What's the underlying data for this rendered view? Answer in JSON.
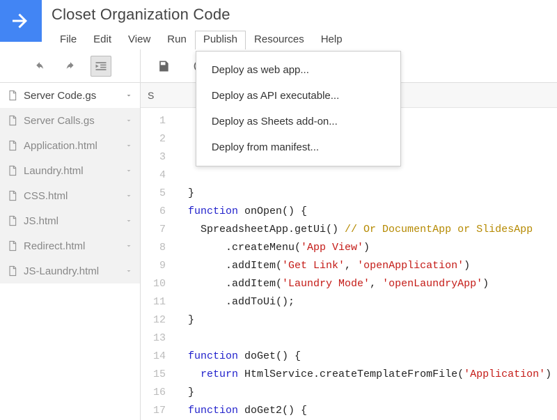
{
  "doc_title": "Closet Organization Code",
  "menubar": {
    "file": "File",
    "edit": "Edit",
    "view": "View",
    "run": "Run",
    "publish": "Publish",
    "resources": "Resources",
    "help": "Help"
  },
  "publish_menu": {
    "web_app": "Deploy as web app...",
    "api_exec": "Deploy as API executable...",
    "sheets_addon": "Deploy as Sheets add-on...",
    "manifest": "Deploy from manifest..."
  },
  "files": [
    {
      "name": "Server Code.gs",
      "active": true
    },
    {
      "name": "Server Calls.gs",
      "active": false
    },
    {
      "name": "Application.html",
      "active": false
    },
    {
      "name": "Laundry.html",
      "active": false
    },
    {
      "name": "CSS.html",
      "active": false
    },
    {
      "name": "JS.html",
      "active": false
    },
    {
      "name": "Redirect.html",
      "active": false
    },
    {
      "name": "JS-Laundry.html",
      "active": false
    }
  ],
  "fn_selector_label": "S",
  "code_lines": [
    "",
    "",
    "",
    "",
    "  }",
    "  function onOpen() {",
    "    SpreadsheetApp.getUi() // Or DocumentApp or SlidesApp",
    "        .createMenu('App View')",
    "        .addItem('Get Link', 'openApplication')",
    "        .addItem('Laundry Mode', 'openLaundryApp')",
    "        .addToUi();",
    "  }",
    "",
    "  function doGet() {",
    "    return HtmlService.createTemplateFromFile('Application')",
    "  }",
    "  function doGet2() {"
  ]
}
